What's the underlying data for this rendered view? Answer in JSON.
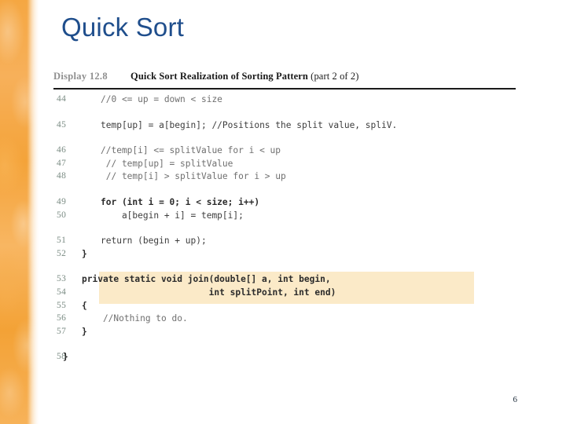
{
  "slide": {
    "title": "Quick Sort",
    "page_number": "6",
    "accent_color": "#1f4e8c",
    "band_color": "#f5a742",
    "highlight_color": "#fbeac8"
  },
  "figure": {
    "display_label": "Display 12.8",
    "caption_title": "Quick Sort Realization of Sorting Pattern",
    "caption_part": " (part 2 of 2)",
    "code_lines": [
      {
        "no": "44",
        "text": "//0 <= up = down < size",
        "style": "comment",
        "gap": false
      },
      {
        "no": "45",
        "text": "temp[up] = a[begin]; //Positions the split value, spliV.",
        "style": "plain",
        "gap": true
      },
      {
        "no": "46",
        "text": "//temp[i] <= splitValue for i < up",
        "style": "comment",
        "gap": true
      },
      {
        "no": "47",
        "text": " // temp[up] = splitValue",
        "style": "comment",
        "gap": false
      },
      {
        "no": "48",
        "text": " // temp[i] > splitValue for i > up",
        "style": "comment",
        "gap": false
      },
      {
        "no": "49",
        "text": "for (int i = 0; i < size; i++)",
        "style": "bold",
        "gap": true
      },
      {
        "no": "50",
        "text": "    a[begin + i] = temp[i];",
        "style": "plain",
        "gap": false
      },
      {
        "no": "51",
        "text": "return (begin + up);",
        "style": "plain",
        "gap": true
      },
      {
        "no": "52",
        "text": "}",
        "style": "bold",
        "indent": -24,
        "gap": false
      },
      {
        "no": "53",
        "text": "private static void join(double[] a, int begin,",
        "style": "bold",
        "indent": -24,
        "gap": true
      },
      {
        "no": "54",
        "text": "                        int splitPoint, int end)",
        "style": "bold",
        "indent": -24,
        "gap": false
      },
      {
        "no": "55",
        "text": "{",
        "style": "bold",
        "indent": -24,
        "gap": false
      },
      {
        "no": "56",
        "text": "    //Nothing to do.",
        "style": "comment",
        "indent": -24,
        "gap": false
      },
      {
        "no": "57",
        "text": "}",
        "style": "bold",
        "indent": -24,
        "gap": false
      },
      {
        "no": "58",
        "text": "}",
        "style": "bold",
        "indent": -48,
        "gap": true
      }
    ]
  }
}
